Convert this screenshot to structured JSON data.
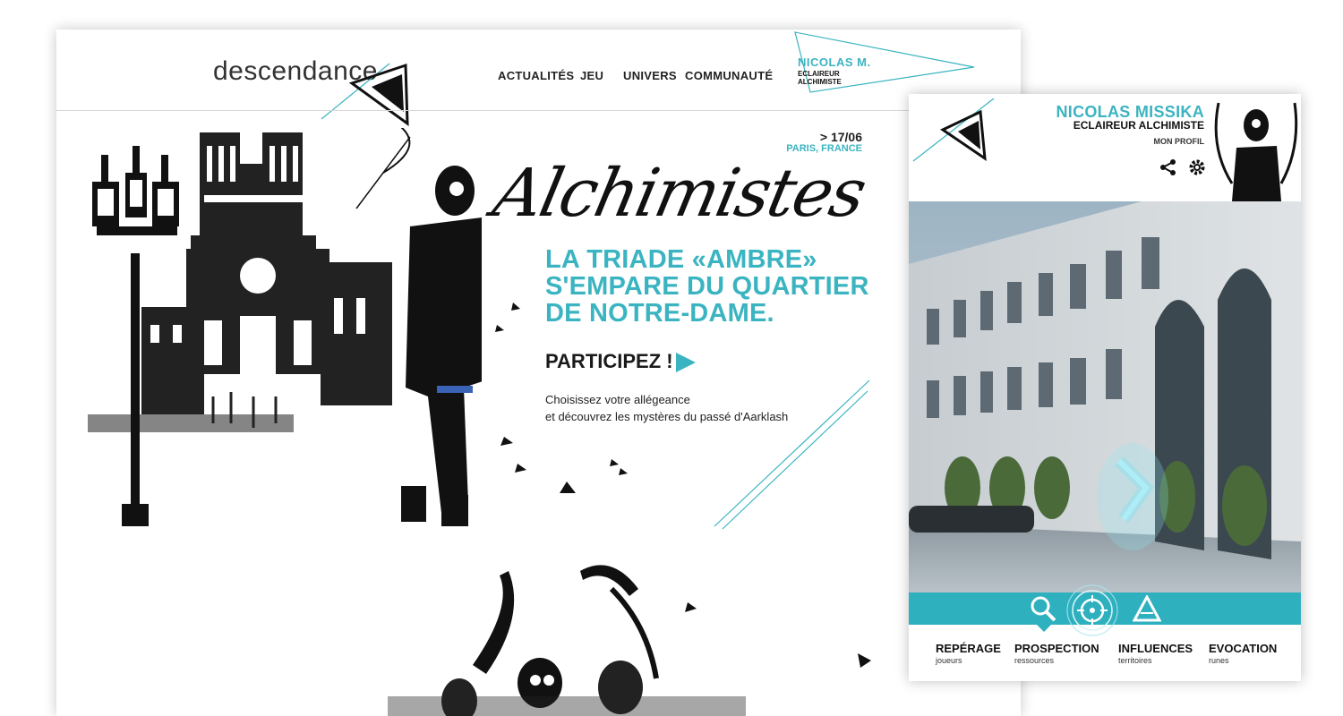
{
  "desktop": {
    "logo": "descendance",
    "nav": [
      "ACTUALITÉS",
      "JEU",
      "UNIVERS",
      "COMMUNAUTÉ"
    ],
    "user": {
      "name": "NICOLAS M.",
      "role_line1": "ECLAIREUR",
      "role_line2": "ALCHIMISTE"
    },
    "event": {
      "date": "> 17/06",
      "place": "PARIS, FRANCE"
    },
    "script_title": "Alchimistes",
    "headline": "LA TRIADE «AMBRE» S'EMPARE DU QUARTIER DE NOTRE-DAME.",
    "cta": "PARTICIPEZ !",
    "desc_line1": "Choisissez votre allégeance",
    "desc_line2": "et découvrez les mystères du passé d'Aarklash"
  },
  "mobile": {
    "name": "NICOLAS MISSIKA",
    "role": "ECLAIREUR ALCHIMISTE",
    "profile_link": "MON PROFIL",
    "tabs": [
      {
        "title": "REPÉRAGE",
        "sub": "joueurs"
      },
      {
        "title": "PROSPECTION",
        "sub": "ressources"
      },
      {
        "title": "INFLUENCES",
        "sub": "territoires"
      },
      {
        "title": "EVOCATION",
        "sub": "runes"
      }
    ]
  },
  "colors": {
    "accent": "#3bb4c1",
    "bar": "#2fb0bf",
    "text": "#1a1a1a"
  }
}
